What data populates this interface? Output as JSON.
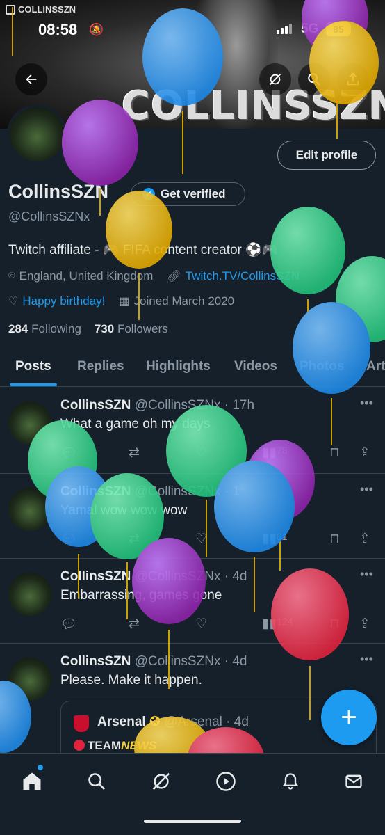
{
  "watermark": "COLLINSSZN",
  "status": {
    "time": "08:58",
    "network": "5G",
    "battery": "85"
  },
  "banner": {
    "title": "COLLINSSZN"
  },
  "profile": {
    "edit_label": "Edit profile",
    "display_name": "CollinsSZN",
    "verify_label": "Get verified",
    "handle": "@CollinsSZNx",
    "bio": "Twitch affiliate - 🎮 FIFA content creator ⚽️🎮",
    "location": "England, United Kingdom",
    "link": "Twitch.TV/CollinsSZN",
    "birthday": "Happy birthday!",
    "joined": "Joined March 2020",
    "following_count": "284",
    "following_label": "Following",
    "followers_count": "730",
    "followers_label": "Followers"
  },
  "tabs": [
    {
      "label": "Posts"
    },
    {
      "label": "Replies"
    },
    {
      "label": "Highlights"
    },
    {
      "label": "Videos"
    },
    {
      "label": "Photos"
    },
    {
      "label": "Art"
    }
  ],
  "posts": [
    {
      "name": "CollinsSZN",
      "handle": "@CollinsSZNx · 17h",
      "text": "What a game oh my days",
      "views": "78"
    },
    {
      "name": "CollinsSZN",
      "handle": "@CollinsSZNx · 1",
      "text": "Yamal wow wow wow",
      "views": "81"
    },
    {
      "name": "CollinsSZN",
      "handle": "@CollinsSZNx · 4d",
      "text": "Embarrassing, games gone",
      "views": "124"
    },
    {
      "name": "CollinsSZN",
      "handle": "@CollinsSZNx · 4d",
      "text": "Please. Make it happen.",
      "quote": {
        "name": "Arsenal",
        "handle": "@Arsenal · 4d",
        "text_prefix": "TEAM",
        "text_accent": "NEWS"
      }
    }
  ],
  "icons": {
    "back": "arrow-left-icon",
    "pin": "grok-icon",
    "search": "search-icon",
    "share": "share-icon",
    "reply": "reply-icon",
    "repost": "repost-icon",
    "like": "heart-icon",
    "views": "views-icon",
    "bookmark": "bookmark-icon",
    "compose": "plus-icon"
  },
  "colors": {
    "accent": "#1d9bf0",
    "background": "#15202b",
    "border": "#38444d",
    "secondary_text": "#8b98a5"
  }
}
